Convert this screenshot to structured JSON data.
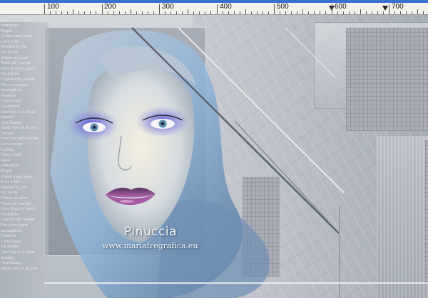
{
  "ruler": {
    "labels": [
      "100",
      "200",
      "300",
      "400",
      "500",
      "600",
      "700"
    ],
    "unit": "px"
  },
  "artwork": {
    "watermark_name": "Pinuccia",
    "watermark_url": "www.mariafregrafica.eu",
    "side_text_lines": [
      "chimaeyez",
      "People",
      "A hath many heart",
      "Love a life",
      "Blinded by you",
      "Let me be",
      "Where are you?",
      "That's all i can be",
      "Over if you're much",
      "Ha and her",
      "Crazed with woman",
      "I'm a love poem",
      "Incomplicity",
      "Freedom",
      "I need some",
      "I'm around",
      "One Day At A Time",
      "Standby",
      "Own beauty",
      "Suddy love is all you",
      "Despair",
      "Hold you with wishes",
      "Love always",
      "Fashion",
      "Dizzy world",
      "Main",
      "chimaeyez",
      "People",
      "A hath many heart",
      "Love a life",
      "Blinded by you",
      "Let me be",
      "Where are you?",
      "That's all i can be",
      "Over if you're much",
      "Ha and her",
      "Crazed with woman",
      "I'm a love poem",
      "Incomplicity",
      "Freedom",
      "I need some",
      "I'm around",
      "One Day At A Time",
      "Standby",
      "Own beauty",
      "Suddy love is all you"
    ]
  },
  "colors": {
    "window_edge": "#3c6fd1",
    "ruler_bg": "#f3f1ec",
    "canvas_bg": "#c3c8cf",
    "eye_shadow": "#5c4fd6",
    "lips": "#8e3f86",
    "hair_tint": "#8fb4d9"
  },
  "icons": {
    "ruler_marker": "triangle-down"
  }
}
